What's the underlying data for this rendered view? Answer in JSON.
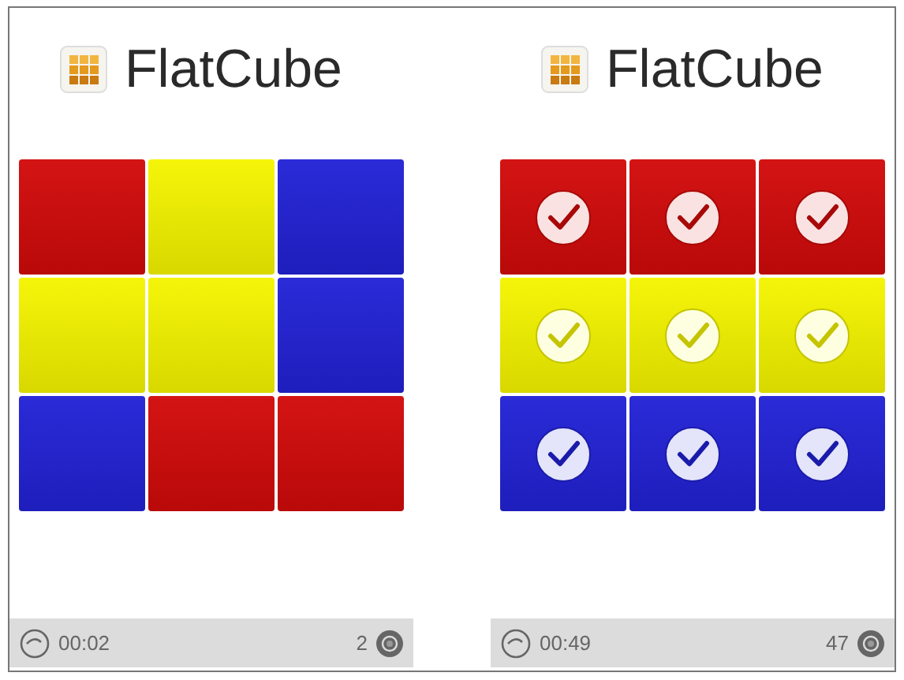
{
  "screens": [
    {
      "title": "FlatCube",
      "time": "00:02",
      "count": "2",
      "tiles": [
        {
          "color": "#d20a0a",
          "checked": false
        },
        {
          "color": "#f5f500",
          "checked": false
        },
        {
          "color": "#2222d6",
          "checked": false
        },
        {
          "color": "#f5f500",
          "checked": false
        },
        {
          "color": "#f5f500",
          "checked": false
        },
        {
          "color": "#2222d6",
          "checked": false
        },
        {
          "color": "#2222d6",
          "checked": false
        },
        {
          "color": "#d20a0a",
          "checked": false
        },
        {
          "color": "#d20a0a",
          "checked": false
        }
      ]
    },
    {
      "title": "FlatCube",
      "time": "00:49",
      "count": "47",
      "tiles": [
        {
          "color": "#d20a0a",
          "checked": true
        },
        {
          "color": "#d20a0a",
          "checked": true
        },
        {
          "color": "#d20a0a",
          "checked": true
        },
        {
          "color": "#f5f500",
          "checked": true
        },
        {
          "color": "#f5f500",
          "checked": true
        },
        {
          "color": "#f5f500",
          "checked": true
        },
        {
          "color": "#2222d6",
          "checked": true
        },
        {
          "color": "#2222d6",
          "checked": true
        },
        {
          "color": "#2222d6",
          "checked": true
        }
      ]
    }
  ]
}
